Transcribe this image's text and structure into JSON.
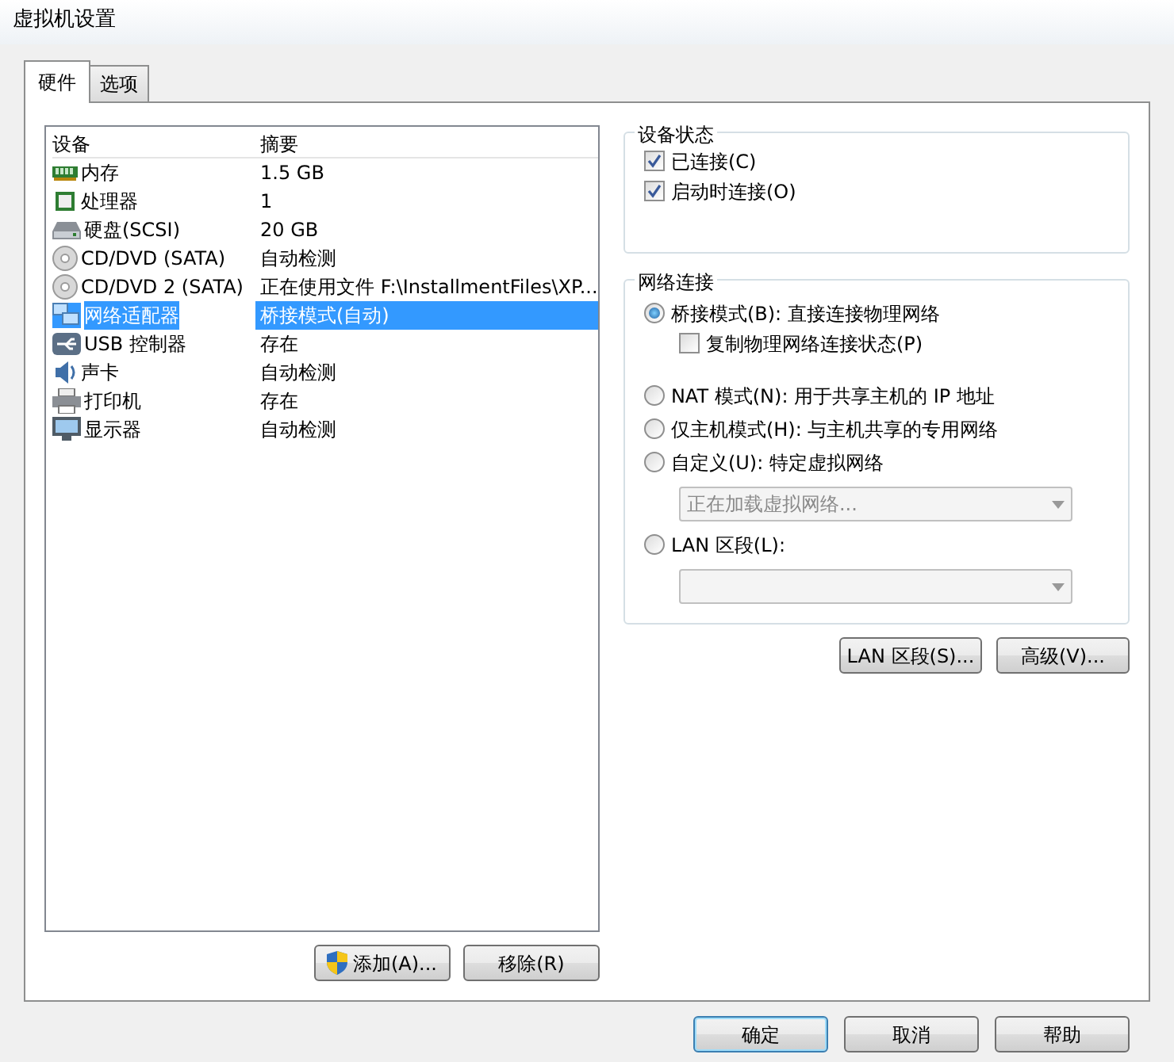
{
  "window": {
    "title": "虚拟机设置"
  },
  "tabs": [
    {
      "label": "硬件",
      "selected": true
    },
    {
      "label": "选项",
      "selected": false
    }
  ],
  "devices": {
    "columns": [
      "设备",
      "摘要"
    ],
    "rows": [
      {
        "kind": "memory",
        "device": "内存",
        "summary": "1.5 GB",
        "selected": false
      },
      {
        "kind": "cpu",
        "device": "处理器",
        "summary": "1",
        "selected": false
      },
      {
        "kind": "disk",
        "device": "硬盘(SCSI)",
        "summary": "20 GB",
        "selected": false
      },
      {
        "kind": "cd",
        "device": "CD/DVD (SATA)",
        "summary": "自动检测",
        "selected": false
      },
      {
        "kind": "cd",
        "device": "CD/DVD 2 (SATA)",
        "summary": "正在使用文件 F:\\InstallmentFiles\\XP...",
        "selected": false
      },
      {
        "kind": "network",
        "device": "网络适配器",
        "summary": "桥接模式(自动)",
        "selected": true
      },
      {
        "kind": "usb",
        "device": "USB 控制器",
        "summary": "存在",
        "selected": false
      },
      {
        "kind": "sound",
        "device": "声卡",
        "summary": "自动检测",
        "selected": false
      },
      {
        "kind": "printer",
        "device": "打印机",
        "summary": "存在",
        "selected": false
      },
      {
        "kind": "display",
        "device": "显示器",
        "summary": "自动检测",
        "selected": false
      }
    ]
  },
  "list_buttons": [
    {
      "label": "添加(A)...",
      "shield": true
    },
    {
      "label": "移除(R)",
      "shield": false
    }
  ],
  "device_status": {
    "title": "设备状态",
    "items": [
      {
        "label": "已连接(C)",
        "checked": true
      },
      {
        "label": "启动时连接(O)",
        "checked": true
      }
    ]
  },
  "network": {
    "title": "网络连接",
    "items": [
      {
        "kind": "radio",
        "label": "桥接模式(B): 直接连接物理网络",
        "selected": true
      },
      {
        "kind": "checkbox",
        "label": "复制物理网络连接状态(P)",
        "checked": false
      },
      {
        "kind": "radio",
        "label": "NAT 模式(N): 用于共享主机的 IP 地址",
        "selected": false
      },
      {
        "kind": "radio",
        "label": "仅主机模式(H): 与主机共享的专用网络",
        "selected": false
      },
      {
        "kind": "radio",
        "label": "自定义(U): 特定虚拟网络",
        "selected": false
      },
      {
        "kind": "select",
        "value": "正在加载虚拟网络...",
        "disabled": true
      },
      {
        "kind": "radio",
        "label": "LAN 区段(L):",
        "selected": false
      },
      {
        "kind": "select",
        "disabled": true
      }
    ]
  },
  "network_buttons": [
    "LAN 区段(S)...",
    "高级(V)..."
  ],
  "dialog_buttons": [
    {
      "label": "确定",
      "default": true
    },
    {
      "label": "取消",
      "default": false
    },
    {
      "label": "帮助",
      "default": false
    }
  ]
}
